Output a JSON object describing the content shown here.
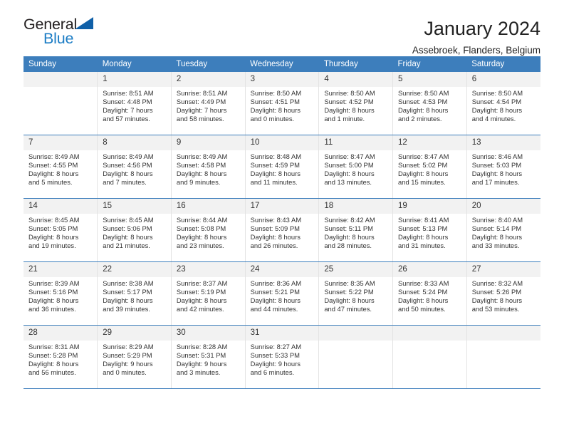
{
  "logo": {
    "word_one": "General",
    "word_two": "Blue",
    "triangle_color": "#1060a8",
    "blue_color": "#1c7dc5"
  },
  "header": {
    "title": "January 2024",
    "subtitle": "Assebroek, Flanders, Belgium"
  },
  "theme": {
    "header_bg": "#3d7ebc",
    "daynum_bg": "#f2f2f2",
    "text": "#333333"
  },
  "calendar": {
    "weekday_headers": [
      "Sunday",
      "Monday",
      "Tuesday",
      "Wednesday",
      "Thursday",
      "Friday",
      "Saturday"
    ],
    "weeks": [
      [
        {
          "day": "",
          "sunrise": "",
          "sunset": "",
          "daylight_a": "",
          "daylight_b": ""
        },
        {
          "day": "1",
          "sunrise": "Sunrise: 8:51 AM",
          "sunset": "Sunset: 4:48 PM",
          "daylight_a": "Daylight: 7 hours",
          "daylight_b": "and 57 minutes."
        },
        {
          "day": "2",
          "sunrise": "Sunrise: 8:51 AM",
          "sunset": "Sunset: 4:49 PM",
          "daylight_a": "Daylight: 7 hours",
          "daylight_b": "and 58 minutes."
        },
        {
          "day": "3",
          "sunrise": "Sunrise: 8:50 AM",
          "sunset": "Sunset: 4:51 PM",
          "daylight_a": "Daylight: 8 hours",
          "daylight_b": "and 0 minutes."
        },
        {
          "day": "4",
          "sunrise": "Sunrise: 8:50 AM",
          "sunset": "Sunset: 4:52 PM",
          "daylight_a": "Daylight: 8 hours",
          "daylight_b": "and 1 minute."
        },
        {
          "day": "5",
          "sunrise": "Sunrise: 8:50 AM",
          "sunset": "Sunset: 4:53 PM",
          "daylight_a": "Daylight: 8 hours",
          "daylight_b": "and 2 minutes."
        },
        {
          "day": "6",
          "sunrise": "Sunrise: 8:50 AM",
          "sunset": "Sunset: 4:54 PM",
          "daylight_a": "Daylight: 8 hours",
          "daylight_b": "and 4 minutes."
        }
      ],
      [
        {
          "day": "7",
          "sunrise": "Sunrise: 8:49 AM",
          "sunset": "Sunset: 4:55 PM",
          "daylight_a": "Daylight: 8 hours",
          "daylight_b": "and 5 minutes."
        },
        {
          "day": "8",
          "sunrise": "Sunrise: 8:49 AM",
          "sunset": "Sunset: 4:56 PM",
          "daylight_a": "Daylight: 8 hours",
          "daylight_b": "and 7 minutes."
        },
        {
          "day": "9",
          "sunrise": "Sunrise: 8:49 AM",
          "sunset": "Sunset: 4:58 PM",
          "daylight_a": "Daylight: 8 hours",
          "daylight_b": "and 9 minutes."
        },
        {
          "day": "10",
          "sunrise": "Sunrise: 8:48 AM",
          "sunset": "Sunset: 4:59 PM",
          "daylight_a": "Daylight: 8 hours",
          "daylight_b": "and 11 minutes."
        },
        {
          "day": "11",
          "sunrise": "Sunrise: 8:47 AM",
          "sunset": "Sunset: 5:00 PM",
          "daylight_a": "Daylight: 8 hours",
          "daylight_b": "and 13 minutes."
        },
        {
          "day": "12",
          "sunrise": "Sunrise: 8:47 AM",
          "sunset": "Sunset: 5:02 PM",
          "daylight_a": "Daylight: 8 hours",
          "daylight_b": "and 15 minutes."
        },
        {
          "day": "13",
          "sunrise": "Sunrise: 8:46 AM",
          "sunset": "Sunset: 5:03 PM",
          "daylight_a": "Daylight: 8 hours",
          "daylight_b": "and 17 minutes."
        }
      ],
      [
        {
          "day": "14",
          "sunrise": "Sunrise: 8:45 AM",
          "sunset": "Sunset: 5:05 PM",
          "daylight_a": "Daylight: 8 hours",
          "daylight_b": "and 19 minutes."
        },
        {
          "day": "15",
          "sunrise": "Sunrise: 8:45 AM",
          "sunset": "Sunset: 5:06 PM",
          "daylight_a": "Daylight: 8 hours",
          "daylight_b": "and 21 minutes."
        },
        {
          "day": "16",
          "sunrise": "Sunrise: 8:44 AM",
          "sunset": "Sunset: 5:08 PM",
          "daylight_a": "Daylight: 8 hours",
          "daylight_b": "and 23 minutes."
        },
        {
          "day": "17",
          "sunrise": "Sunrise: 8:43 AM",
          "sunset": "Sunset: 5:09 PM",
          "daylight_a": "Daylight: 8 hours",
          "daylight_b": "and 26 minutes."
        },
        {
          "day": "18",
          "sunrise": "Sunrise: 8:42 AM",
          "sunset": "Sunset: 5:11 PM",
          "daylight_a": "Daylight: 8 hours",
          "daylight_b": "and 28 minutes."
        },
        {
          "day": "19",
          "sunrise": "Sunrise: 8:41 AM",
          "sunset": "Sunset: 5:13 PM",
          "daylight_a": "Daylight: 8 hours",
          "daylight_b": "and 31 minutes."
        },
        {
          "day": "20",
          "sunrise": "Sunrise: 8:40 AM",
          "sunset": "Sunset: 5:14 PM",
          "daylight_a": "Daylight: 8 hours",
          "daylight_b": "and 33 minutes."
        }
      ],
      [
        {
          "day": "21",
          "sunrise": "Sunrise: 8:39 AM",
          "sunset": "Sunset: 5:16 PM",
          "daylight_a": "Daylight: 8 hours",
          "daylight_b": "and 36 minutes."
        },
        {
          "day": "22",
          "sunrise": "Sunrise: 8:38 AM",
          "sunset": "Sunset: 5:17 PM",
          "daylight_a": "Daylight: 8 hours",
          "daylight_b": "and 39 minutes."
        },
        {
          "day": "23",
          "sunrise": "Sunrise: 8:37 AM",
          "sunset": "Sunset: 5:19 PM",
          "daylight_a": "Daylight: 8 hours",
          "daylight_b": "and 42 minutes."
        },
        {
          "day": "24",
          "sunrise": "Sunrise: 8:36 AM",
          "sunset": "Sunset: 5:21 PM",
          "daylight_a": "Daylight: 8 hours",
          "daylight_b": "and 44 minutes."
        },
        {
          "day": "25",
          "sunrise": "Sunrise: 8:35 AM",
          "sunset": "Sunset: 5:22 PM",
          "daylight_a": "Daylight: 8 hours",
          "daylight_b": "and 47 minutes."
        },
        {
          "day": "26",
          "sunrise": "Sunrise: 8:33 AM",
          "sunset": "Sunset: 5:24 PM",
          "daylight_a": "Daylight: 8 hours",
          "daylight_b": "and 50 minutes."
        },
        {
          "day": "27",
          "sunrise": "Sunrise: 8:32 AM",
          "sunset": "Sunset: 5:26 PM",
          "daylight_a": "Daylight: 8 hours",
          "daylight_b": "and 53 minutes."
        }
      ],
      [
        {
          "day": "28",
          "sunrise": "Sunrise: 8:31 AM",
          "sunset": "Sunset: 5:28 PM",
          "daylight_a": "Daylight: 8 hours",
          "daylight_b": "and 56 minutes."
        },
        {
          "day": "29",
          "sunrise": "Sunrise: 8:29 AM",
          "sunset": "Sunset: 5:29 PM",
          "daylight_a": "Daylight: 9 hours",
          "daylight_b": "and 0 minutes."
        },
        {
          "day": "30",
          "sunrise": "Sunrise: 8:28 AM",
          "sunset": "Sunset: 5:31 PM",
          "daylight_a": "Daylight: 9 hours",
          "daylight_b": "and 3 minutes."
        },
        {
          "day": "31",
          "sunrise": "Sunrise: 8:27 AM",
          "sunset": "Sunset: 5:33 PM",
          "daylight_a": "Daylight: 9 hours",
          "daylight_b": "and 6 minutes."
        },
        {
          "day": "",
          "sunrise": "",
          "sunset": "",
          "daylight_a": "",
          "daylight_b": ""
        },
        {
          "day": "",
          "sunrise": "",
          "sunset": "",
          "daylight_a": "",
          "daylight_b": ""
        },
        {
          "day": "",
          "sunrise": "",
          "sunset": "",
          "daylight_a": "",
          "daylight_b": ""
        }
      ]
    ]
  }
}
